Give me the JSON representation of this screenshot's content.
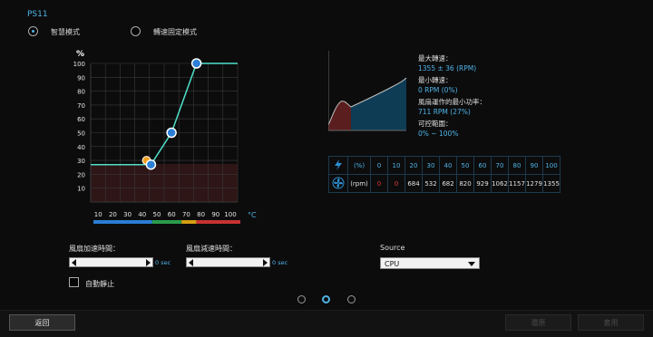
{
  "panel": {
    "title": "PS11"
  },
  "modes": [
    {
      "label": "智慧模式",
      "selected": true
    },
    {
      "label": "轉速固定模式",
      "selected": false
    }
  ],
  "curve_chart": {
    "ylabel": "%",
    "xlabel": "°C",
    "y_ticks": [
      "100",
      "90",
      "80",
      "70",
      "60",
      "50",
      "40",
      "30",
      "20",
      "10"
    ],
    "x_ticks": [
      "10",
      "20",
      "30",
      "40",
      "50",
      "60",
      "70",
      "80",
      "90",
      "100"
    ],
    "ylim": [
      0,
      100
    ],
    "xlim": [
      0,
      100
    ],
    "points": [
      {
        "temp": 41,
        "percent": 27
      },
      {
        "temp": 55,
        "percent": 50
      },
      {
        "temp": 72,
        "percent": 100
      }
    ],
    "start_percent": 27,
    "end_temp": 100,
    "marker": {
      "temp": 38,
      "percent": 30
    },
    "temp_bands": [
      {
        "from": 0,
        "to": 40,
        "color": "#2a7dd4"
      },
      {
        "from": 40,
        "to": 60,
        "color": "#2a9b4a"
      },
      {
        "from": 60,
        "to": 70,
        "color": "#d4a012"
      },
      {
        "from": 70,
        "to": 100,
        "color": "#c83232"
      }
    ],
    "colors": {
      "curve": "#4fe0c8",
      "point": "#2b7fd6",
      "marker": "#f0a020",
      "accent": "#4fb3e6"
    }
  },
  "fan_info": {
    "max_speed_label": "最大轉速：",
    "max_speed_value": "1355 ± 36 (RPM)",
    "min_speed_label": "最小轉速：",
    "min_speed_value": "0 RPM (0%)",
    "min_power_label": "風扇運作的最小功率：",
    "min_power_value": "711 RPM (27%)",
    "range_label": "可控範圍：",
    "range_value": "0% ~ 100%"
  },
  "rpm_table": {
    "power_unit": "(%)",
    "rpm_unit": "(rpm)",
    "percent": [
      "0",
      "10",
      "20",
      "30",
      "40",
      "50",
      "60",
      "70",
      "80",
      "90",
      "100"
    ],
    "rpm": [
      "0",
      "0",
      "684",
      "532",
      "682",
      "820",
      "929",
      "1062",
      "1157",
      "1279",
      "1355"
    ],
    "icons": [
      "lightning-icon",
      "fan-icon"
    ]
  },
  "speed_up": {
    "label": "風扇加速時間：",
    "value": "0 sec"
  },
  "slow_down": {
    "label": "風扇減速時間：",
    "value": "0 sec"
  },
  "source": {
    "label": "Source",
    "selected": "CPU"
  },
  "auto_stop": {
    "label": "自動靜止",
    "checked": false
  },
  "pagination": {
    "count": 3,
    "active": 2
  },
  "buttons": {
    "back": "返回",
    "cancel": "還原",
    "apply": "套用"
  }
}
